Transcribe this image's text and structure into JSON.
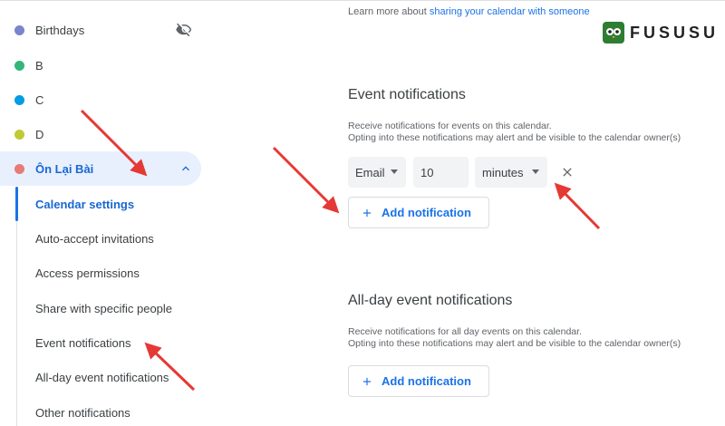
{
  "sidebar": {
    "calendars": [
      {
        "label": "Birthdays",
        "color": "#7986cb"
      },
      {
        "label": "B",
        "color": "#33b679"
      },
      {
        "label": "C",
        "color": "#039be5"
      },
      {
        "label": "D",
        "color": "#c0ca33"
      },
      {
        "label": "Ôn Lại Bài",
        "color": "#e67c73"
      }
    ],
    "settings_items": [
      "Calendar settings",
      "Auto-accept invitations",
      "Access permissions",
      "Share with specific people",
      "Event notifications",
      "All-day event notifications",
      "Other notifications"
    ]
  },
  "main": {
    "learn_prefix": "Learn more about ",
    "learn_link": "sharing your calendar with someone",
    "event_notifications": {
      "title": "Event notifications",
      "desc_line1": "Receive notifications for events on this calendar.",
      "desc_line2": "Opting into these notifications may alert and be visible to the calendar owner(s)",
      "method": "Email",
      "amount": "10",
      "unit": "minutes",
      "add_label": "Add notification"
    },
    "allday_notifications": {
      "title": "All-day event notifications",
      "desc_line1": "Receive notifications for all day events on this calendar.",
      "desc_line2": "Opting into these notifications may alert and be visible to the calendar owner(s)",
      "add_label": "Add notification"
    }
  },
  "logo": {
    "text": "FUSUSU"
  },
  "colors": {
    "accent": "#1a73e8",
    "active_bg": "#e8f0fe",
    "arrow": "#e53935"
  }
}
